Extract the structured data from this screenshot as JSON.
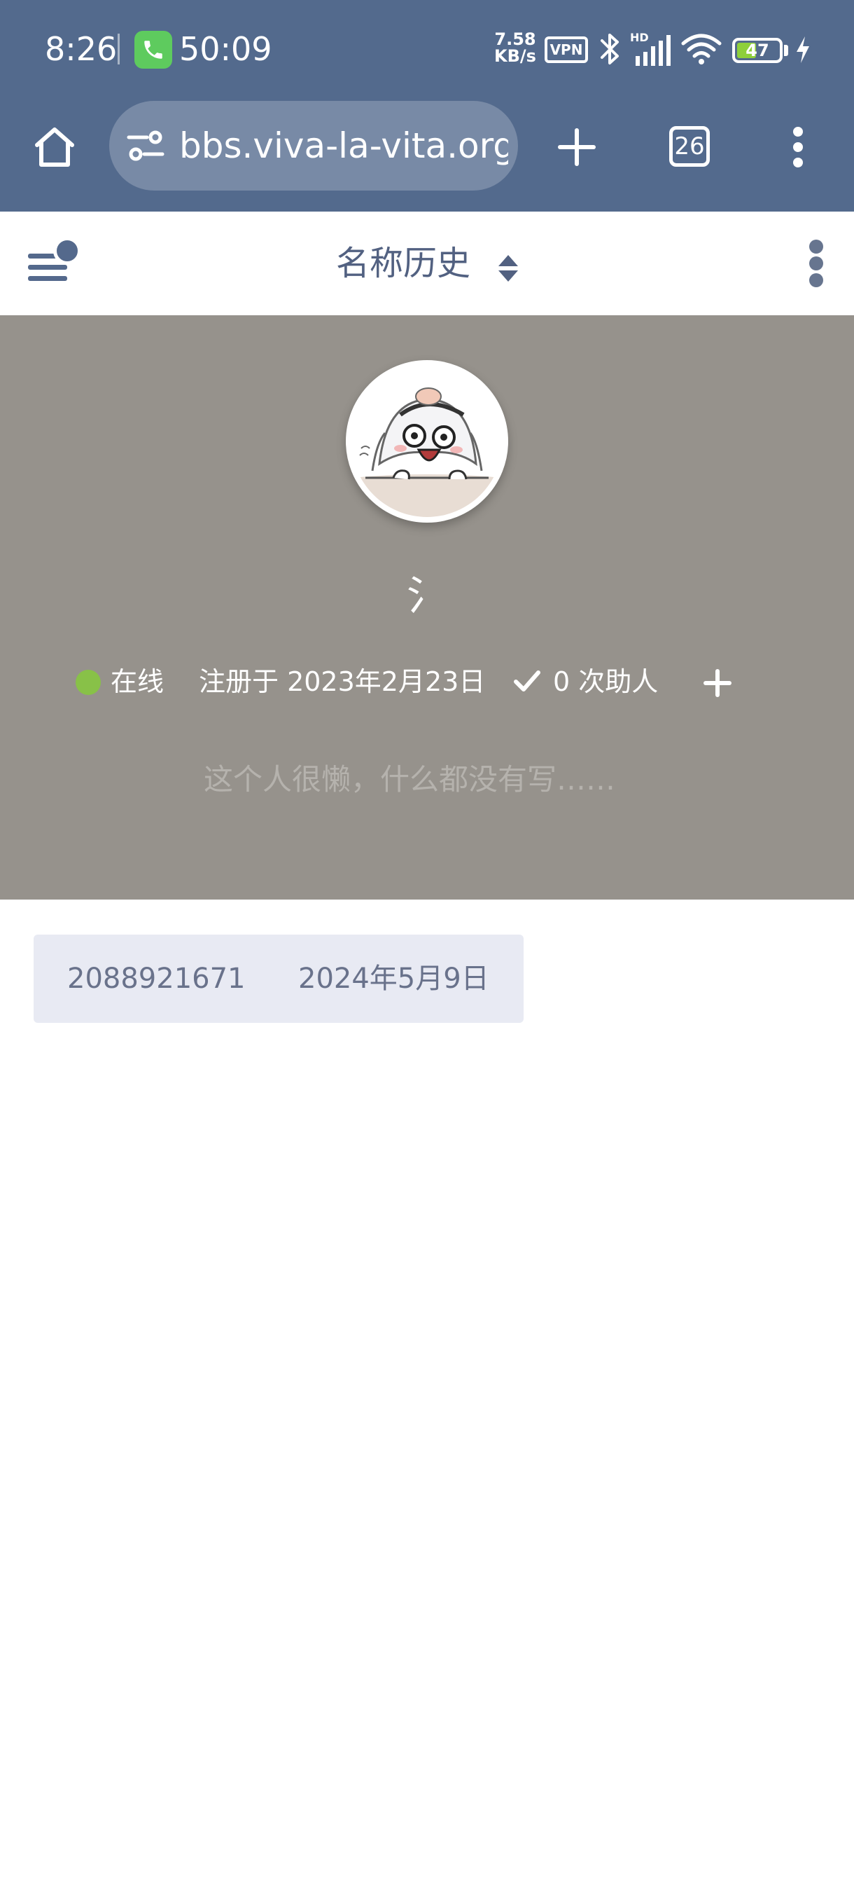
{
  "status_bar": {
    "time": "8:26",
    "call_timer": "50:09",
    "net_speed_value": "7.58",
    "net_speed_unit": "KB/s",
    "vpn_label": "VPN",
    "hd_label": "HD",
    "battery_level": "47",
    "battery_fraction": 0.47,
    "battery_color": "#8ecf3b",
    "icons": [
      "phone-icon",
      "bluetooth-icon",
      "cell-signal-icon",
      "wifi-icon",
      "charging-bolt-icon"
    ]
  },
  "browser": {
    "url": "bbs.viva-la-vita.org",
    "tab_count": "26",
    "chrome_color": "#536a8d",
    "icons": [
      "home-icon",
      "site-settings-icon",
      "new-tab-plus-icon",
      "more-vert-icon"
    ]
  },
  "header": {
    "title": "名称历史",
    "icons": [
      "menu-icon",
      "sort-icon",
      "more-vert-icon"
    ]
  },
  "profile": {
    "username": "氵",
    "status": "在线",
    "joined": "注册于 2023年2月23日",
    "helped": "0 次助人",
    "bio": "这个人很懒，什么都没有写……",
    "hero_color": "#96928c",
    "online_color": "#88c148",
    "icons": [
      "avatar",
      "check-icon",
      "plus-icon"
    ]
  },
  "name_history": [
    {
      "name": "2088921671",
      "date": "2024年5月9日"
    }
  ]
}
